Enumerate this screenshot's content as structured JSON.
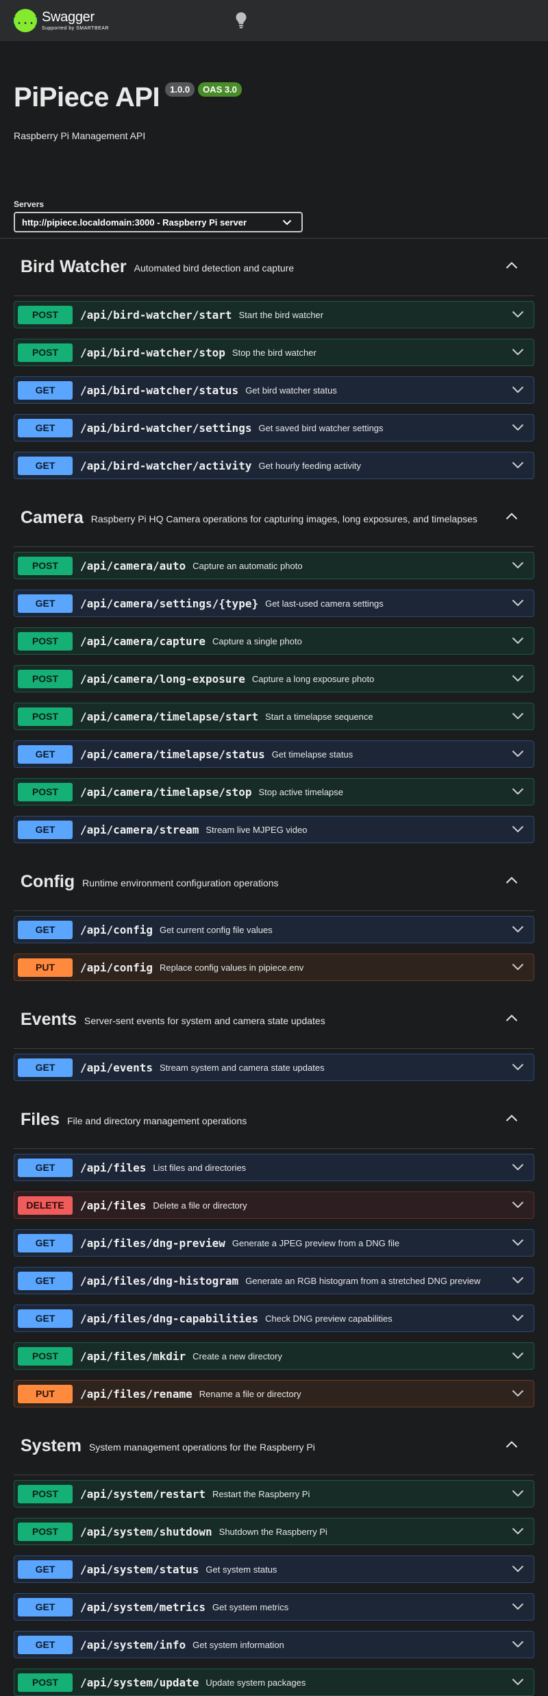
{
  "topbar": {
    "logo_title": "Swagger",
    "logo_sub": "Supported by SMARTBEAR",
    "logo_glyph": "{...}"
  },
  "info": {
    "title": "PiPiece API",
    "version": "1.0.0",
    "oas": "OAS 3.0",
    "description": "Raspberry Pi Management API",
    "servers_label": "Servers",
    "server_selected": "http://pipiece.localdomain:3000 - Raspberry Pi server"
  },
  "colors": {
    "post": "#14b076",
    "get": "#5aa6ff",
    "put": "#ff8a3d",
    "delete": "#f05b5b",
    "logo": "#85ea2d"
  },
  "tags": [
    {
      "name": "Bird Watcher",
      "description": "Automated bird detection and capture",
      "ops": [
        {
          "method": "POST",
          "path": "/api/bird-watcher/start",
          "summary": "Start the bird watcher"
        },
        {
          "method": "POST",
          "path": "/api/bird-watcher/stop",
          "summary": "Stop the bird watcher"
        },
        {
          "method": "GET",
          "path": "/api/bird-watcher/status",
          "summary": "Get bird watcher status"
        },
        {
          "method": "GET",
          "path": "/api/bird-watcher/settings",
          "summary": "Get saved bird watcher settings"
        },
        {
          "method": "GET",
          "path": "/api/bird-watcher/activity",
          "summary": "Get hourly feeding activity"
        }
      ]
    },
    {
      "name": "Camera",
      "description": "Raspberry Pi HQ Camera operations for capturing images, long exposures, and timelapses",
      "ops": [
        {
          "method": "POST",
          "path": "/api/camera/auto",
          "summary": "Capture an automatic photo"
        },
        {
          "method": "GET",
          "path": "/api/camera/settings/{type}",
          "summary": "Get last-used camera settings"
        },
        {
          "method": "POST",
          "path": "/api/camera/capture",
          "summary": "Capture a single photo"
        },
        {
          "method": "POST",
          "path": "/api/camera/long-exposure",
          "summary": "Capture a long exposure photo"
        },
        {
          "method": "POST",
          "path": "/api/camera/timelapse/start",
          "summary": "Start a timelapse sequence"
        },
        {
          "method": "GET",
          "path": "/api/camera/timelapse/status",
          "summary": "Get timelapse status"
        },
        {
          "method": "POST",
          "path": "/api/camera/timelapse/stop",
          "summary": "Stop active timelapse"
        },
        {
          "method": "GET",
          "path": "/api/camera/stream",
          "summary": "Stream live MJPEG video"
        }
      ]
    },
    {
      "name": "Config",
      "description": "Runtime environment configuration operations",
      "ops": [
        {
          "method": "GET",
          "path": "/api/config",
          "summary": "Get current config file values"
        },
        {
          "method": "PUT",
          "path": "/api/config",
          "summary": "Replace config values in pipiece.env"
        }
      ]
    },
    {
      "name": "Events",
      "description": "Server-sent events for system and camera state updates",
      "ops": [
        {
          "method": "GET",
          "path": "/api/events",
          "summary": "Stream system and camera state updates"
        }
      ]
    },
    {
      "name": "Files",
      "description": "File and directory management operations",
      "ops": [
        {
          "method": "GET",
          "path": "/api/files",
          "summary": "List files and directories"
        },
        {
          "method": "DELETE",
          "path": "/api/files",
          "summary": "Delete a file or directory"
        },
        {
          "method": "GET",
          "path": "/api/files/dng-preview",
          "summary": "Generate a JPEG preview from a DNG file"
        },
        {
          "method": "GET",
          "path": "/api/files/dng-histogram",
          "summary": "Generate an RGB histogram from a stretched DNG preview"
        },
        {
          "method": "GET",
          "path": "/api/files/dng-capabilities",
          "summary": "Check DNG preview capabilities"
        },
        {
          "method": "POST",
          "path": "/api/files/mkdir",
          "summary": "Create a new directory"
        },
        {
          "method": "PUT",
          "path": "/api/files/rename",
          "summary": "Rename a file or directory"
        }
      ]
    },
    {
      "name": "System",
      "description": "System management operations for the Raspberry Pi",
      "ops": [
        {
          "method": "POST",
          "path": "/api/system/restart",
          "summary": "Restart the Raspberry Pi"
        },
        {
          "method": "POST",
          "path": "/api/system/shutdown",
          "summary": "Shutdown the Raspberry Pi"
        },
        {
          "method": "GET",
          "path": "/api/system/status",
          "summary": "Get system status"
        },
        {
          "method": "GET",
          "path": "/api/system/metrics",
          "summary": "Get system metrics"
        },
        {
          "method": "GET",
          "path": "/api/system/info",
          "summary": "Get system information"
        },
        {
          "method": "POST",
          "path": "/api/system/update",
          "summary": "Update system packages"
        }
      ]
    }
  ]
}
